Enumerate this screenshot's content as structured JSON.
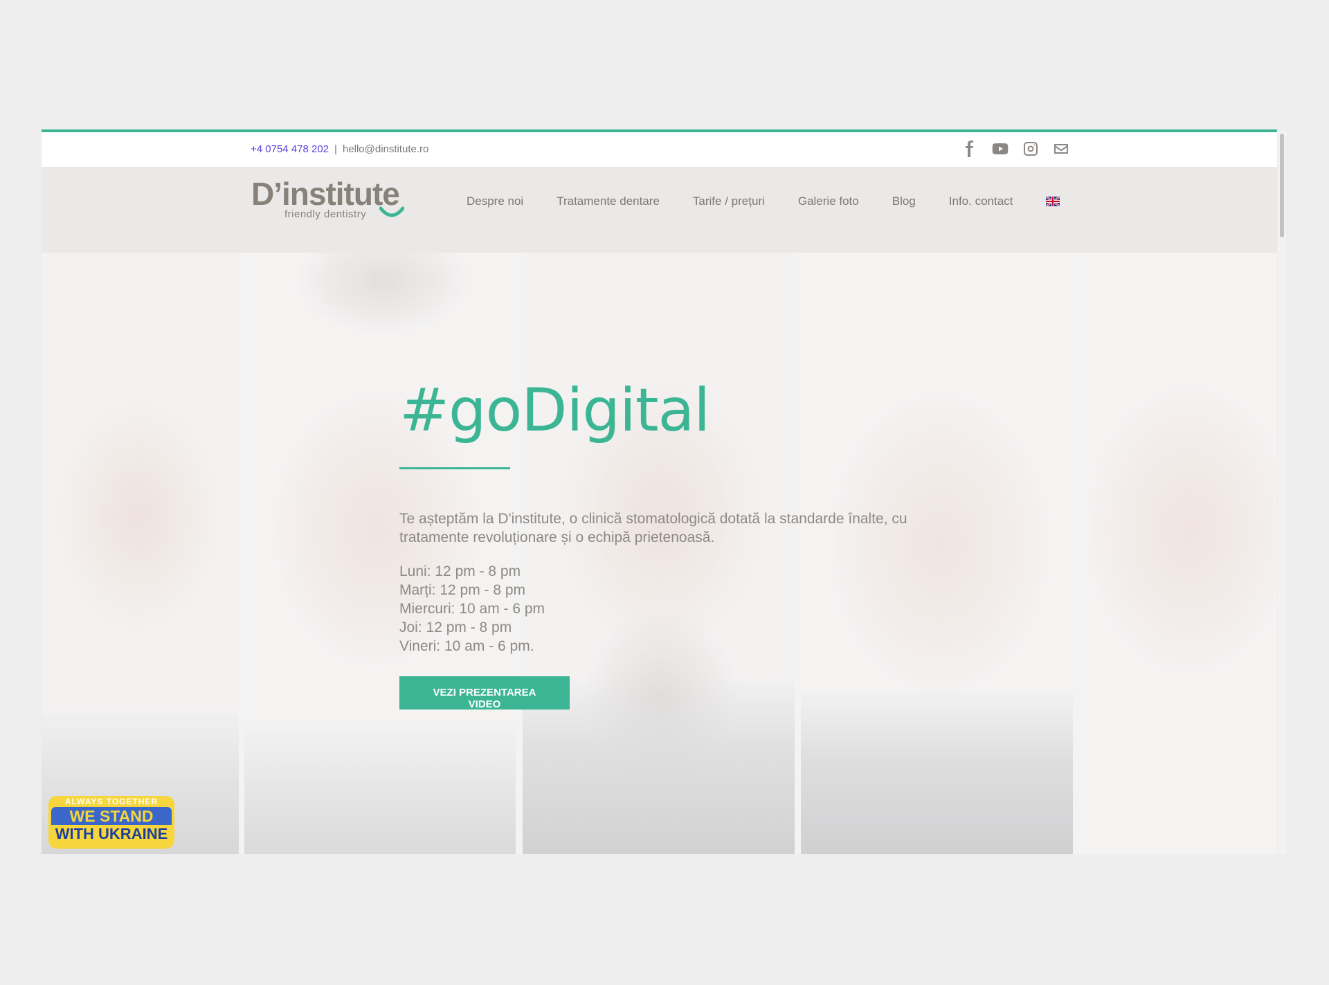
{
  "topbar": {
    "phone": "+4 0754 478 202",
    "separator": "|",
    "email": "hello@dinstitute.ro",
    "social": [
      "facebook-icon",
      "youtube-icon",
      "instagram-icon",
      "mail-icon"
    ]
  },
  "header": {
    "logo_brand": "D’institute",
    "logo_tagline": "friendly dentistry",
    "nav": [
      {
        "label": "Despre noi"
      },
      {
        "label": "Tratamente dentare"
      },
      {
        "label": "Tarife / prețuri"
      },
      {
        "label": "Galerie foto"
      },
      {
        "label": "Blog"
      },
      {
        "label": "Info. contact"
      }
    ],
    "language_icon": "uk-flag-icon"
  },
  "hero": {
    "headline": "#goDigital",
    "lead": "Te așteptăm la D'institute, o clinică stomatologică dotată la standarde înalte, cu tratamente revoluționare și o echipă prietenoasă.",
    "hours": [
      "Luni: 12 pm - 8 pm",
      "Marți: 12 pm - 8 pm",
      "Miercuri: 10 am - 6 pm",
      "Joi: 12 pm - 8 pm",
      "Vineri: 10 am - 6 pm."
    ],
    "cta": "VEZI PREZENTAREA VIDEO"
  },
  "badge": {
    "top": "ALWAYS TOGETHER",
    "line1": "WE STAND",
    "line2": "WITH UKRAINE"
  },
  "colors": {
    "accent": "#3cb595",
    "header_bg": "#eae9e8",
    "text_muted": "#8c8986",
    "phone_link": "#5b3fe0"
  }
}
